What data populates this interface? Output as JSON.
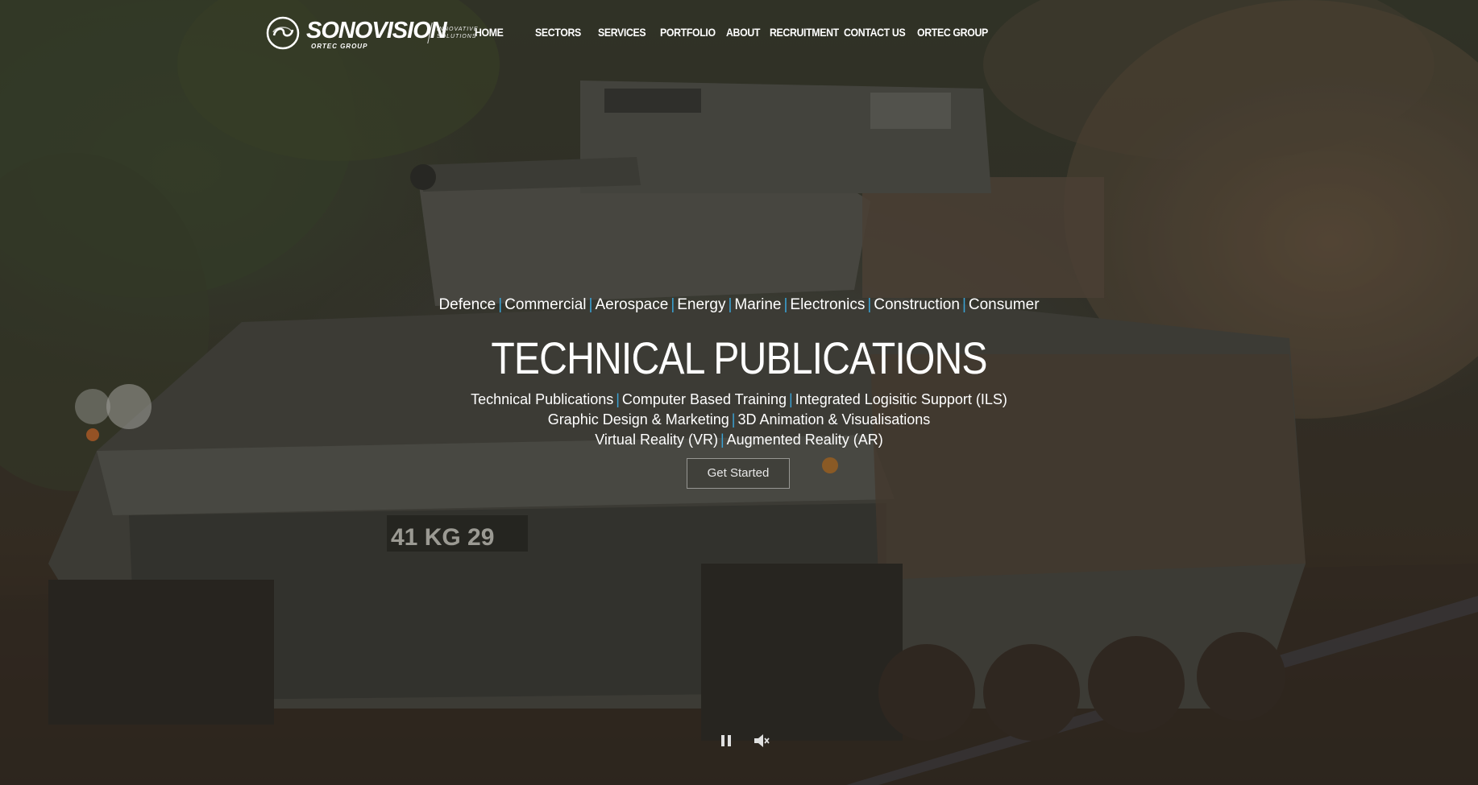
{
  "brand": {
    "name": "SONOVISION",
    "group": "ORTEC GROUP",
    "tagline_line1": "INNOVATIVE",
    "tagline_line2": "SOLUTIONS",
    "icon": "sonovision-logo-icon"
  },
  "nav": {
    "items": [
      {
        "label": "HOME"
      },
      {
        "label": "SECTORS"
      },
      {
        "label": "SERVICES"
      },
      {
        "label": "PORTFOLIO"
      },
      {
        "label": "ABOUT"
      },
      {
        "label": "RECRUITMENT"
      },
      {
        "label": "CONTACT US"
      },
      {
        "label": "ORTEC GROUP"
      }
    ]
  },
  "hero": {
    "sectors": [
      "Defence",
      "Commercial",
      "Aerospace",
      "Energy",
      "Marine",
      "Electronics",
      "Construction",
      "Consumer"
    ],
    "separator": "|",
    "headline": "TECHNICAL PUBLICATIONS",
    "services_lines": [
      [
        "Technical Publications",
        "Computer Based Training",
        "Integrated Logisitic Support (ILS)"
      ],
      [
        "Graphic Design & Marketing",
        "3D Animation & Visualisations"
      ],
      [
        "Virtual Reality (VR)",
        "Augmented Reality (AR)"
      ]
    ],
    "cta_label": "Get Started",
    "vehicle_plate": "41 KG 29"
  },
  "video_controls": {
    "pause_icon": "pause-icon",
    "mute_icon": "speaker-mute-icon"
  },
  "colors": {
    "separator": "#3aa2d4",
    "text": "#ffffff"
  }
}
